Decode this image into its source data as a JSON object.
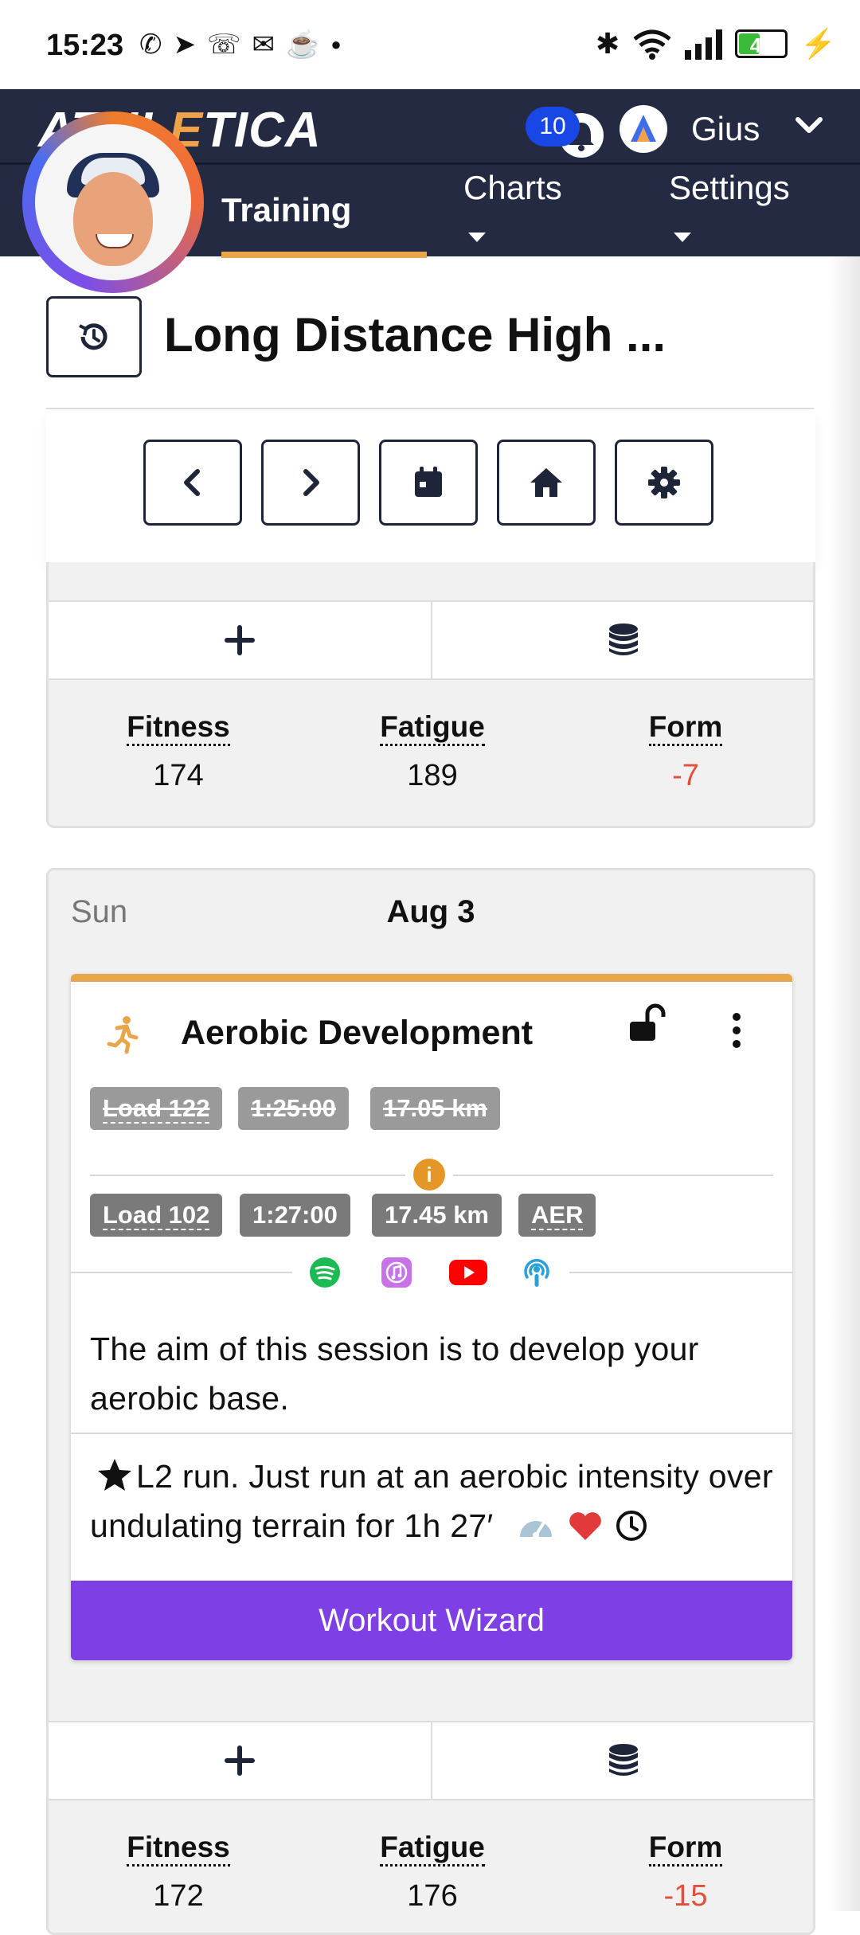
{
  "status_bar": {
    "time": "15:23",
    "battery": "49",
    "battery_level_percent": 49
  },
  "nav": {
    "logo": {
      "part1": "ATHL",
      "part2": "E",
      "part3": "TICA"
    },
    "notification_count": "10",
    "user_name": "Gius",
    "tabs": {
      "training": "Training",
      "charts": "Charts",
      "settings": "Settings"
    }
  },
  "page": {
    "title": "Long Distance High ..."
  },
  "previous_day": {
    "metrics": {
      "fitness_label": "Fitness",
      "fitness": "174",
      "fatigue_label": "Fatigue",
      "fatigue": "189",
      "form_label": "Form",
      "form": "-7"
    }
  },
  "day": {
    "name": "Sun",
    "date": "Aug 3",
    "workout": {
      "title": "Aerobic Development",
      "planned": {
        "load": "Load 122",
        "duration": "1:25:00",
        "distance": "17.05 km"
      },
      "actual": {
        "load": "Load 102",
        "duration": "1:27:00",
        "distance": "17.45 km",
        "zone": "AER"
      },
      "description": "The aim of this session is to develop your aerobic base.",
      "steps": "L2 run. Just run at an aerobic intensity over undulating terrain for 1h 27′",
      "wizard_label": "Workout Wizard"
    },
    "metrics": {
      "fitness_label": "Fitness",
      "fitness": "172",
      "fatigue_label": "Fatigue",
      "fatigue": "176",
      "form_label": "Form",
      "form": "-15"
    }
  },
  "colors": {
    "nav_bg": "#232a42",
    "accent_orange": "#e8a64b",
    "wizard_purple": "#7e3fe4",
    "negative_red": "#e0503a",
    "badge_blue": "#1947e6"
  }
}
